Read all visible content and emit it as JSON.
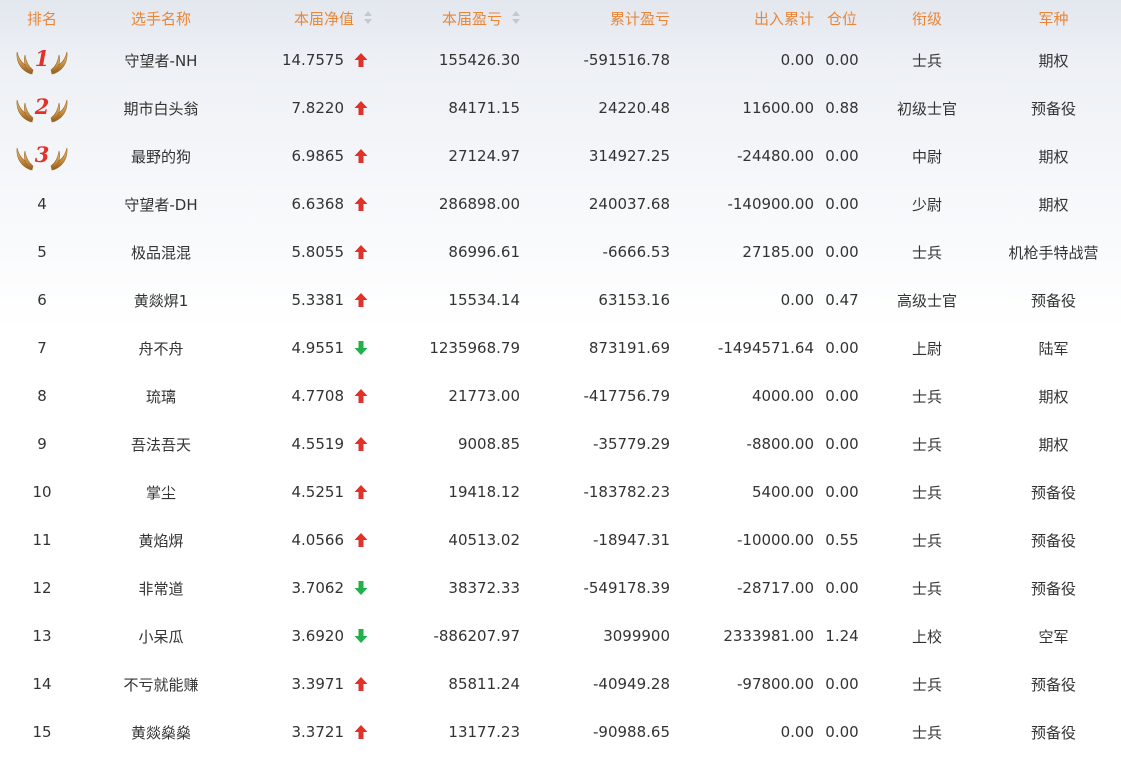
{
  "header": {
    "rank": "排名",
    "name": "选手名称",
    "nav": "本届净值",
    "pnl": "本届盈亏",
    "cumulative": "累计盈亏",
    "inout": "出入累计",
    "position": "仓位",
    "title": "衔级",
    "branch": "军种"
  },
  "colors": {
    "header_text": "#e8873a",
    "arrow_up": "#e0312b",
    "arrow_down": "#22b04b",
    "medal_number": "#e0312b"
  },
  "rows": [
    {
      "rank": "1",
      "name": "守望者-NH",
      "nav": "14.7575",
      "trend": "up",
      "pnl": "155426.30",
      "cumulative": "-591516.78",
      "inout": "0.00",
      "position": "0.00",
      "title": "士兵",
      "branch": "期权"
    },
    {
      "rank": "2",
      "name": "期市白头翁",
      "nav": "7.8220",
      "trend": "up",
      "pnl": "84171.15",
      "cumulative": "24220.48",
      "inout": "11600.00",
      "position": "0.88",
      "title": "初级士官",
      "branch": "预备役"
    },
    {
      "rank": "3",
      "name": "最野的狗",
      "nav": "6.9865",
      "trend": "up",
      "pnl": "27124.97",
      "cumulative": "314927.25",
      "inout": "-24480.00",
      "position": "0.00",
      "title": "中尉",
      "branch": "期权"
    },
    {
      "rank": "4",
      "name": "守望者-DH",
      "nav": "6.6368",
      "trend": "up",
      "pnl": "286898.00",
      "cumulative": "240037.68",
      "inout": "-140900.00",
      "position": "0.00",
      "title": "少尉",
      "branch": "期权"
    },
    {
      "rank": "5",
      "name": "极品混混",
      "nav": "5.8055",
      "trend": "up",
      "pnl": "86996.61",
      "cumulative": "-6666.53",
      "inout": "27185.00",
      "position": "0.00",
      "title": "士兵",
      "branch": "机枪手特战营"
    },
    {
      "rank": "6",
      "name": "黄燚焺1",
      "nav": "5.3381",
      "trend": "up",
      "pnl": "15534.14",
      "cumulative": "63153.16",
      "inout": "0.00",
      "position": "0.47",
      "title": "高级士官",
      "branch": "预备役"
    },
    {
      "rank": "7",
      "name": "舟不舟",
      "nav": "4.9551",
      "trend": "down",
      "pnl": "1235968.79",
      "cumulative": "873191.69",
      "inout": "-1494571.64",
      "position": "0.00",
      "title": "上尉",
      "branch": "陆军"
    },
    {
      "rank": "8",
      "name": "琉璃",
      "nav": "4.7708",
      "trend": "up",
      "pnl": "21773.00",
      "cumulative": "-417756.79",
      "inout": "4000.00",
      "position": "0.00",
      "title": "士兵",
      "branch": "期权"
    },
    {
      "rank": "9",
      "name": "吾法吾天",
      "nav": "4.5519",
      "trend": "up",
      "pnl": "9008.85",
      "cumulative": "-35779.29",
      "inout": "-8800.00",
      "position": "0.00",
      "title": "士兵",
      "branch": "期权"
    },
    {
      "rank": "10",
      "name": "掌尘",
      "nav": "4.5251",
      "trend": "up",
      "pnl": "19418.12",
      "cumulative": "-183782.23",
      "inout": "5400.00",
      "position": "0.00",
      "title": "士兵",
      "branch": "预备役"
    },
    {
      "rank": "11",
      "name": "黄焰焺",
      "nav": "4.0566",
      "trend": "up",
      "pnl": "40513.02",
      "cumulative": "-18947.31",
      "inout": "-10000.00",
      "position": "0.55",
      "title": "士兵",
      "branch": "预备役"
    },
    {
      "rank": "12",
      "name": "非常道",
      "nav": "3.7062",
      "trend": "down",
      "pnl": "38372.33",
      "cumulative": "-549178.39",
      "inout": "-28717.00",
      "position": "0.00",
      "title": "士兵",
      "branch": "预备役"
    },
    {
      "rank": "13",
      "name": "小呆瓜",
      "nav": "3.6920",
      "trend": "down",
      "pnl": "-886207.97",
      "cumulative": "3099900",
      "inout": "2333981.00",
      "position": "1.24",
      "title": "上校",
      "branch": "空军"
    },
    {
      "rank": "14",
      "name": "不亏就能赚",
      "nav": "3.3971",
      "trend": "up",
      "pnl": "85811.24",
      "cumulative": "-40949.28",
      "inout": "-97800.00",
      "position": "0.00",
      "title": "士兵",
      "branch": "预备役"
    },
    {
      "rank": "15",
      "name": "黄燚燊燊",
      "nav": "3.3721",
      "trend": "up",
      "pnl": "13177.23",
      "cumulative": "-90988.65",
      "inout": "0.00",
      "position": "0.00",
      "title": "士兵",
      "branch": "预备役"
    }
  ]
}
